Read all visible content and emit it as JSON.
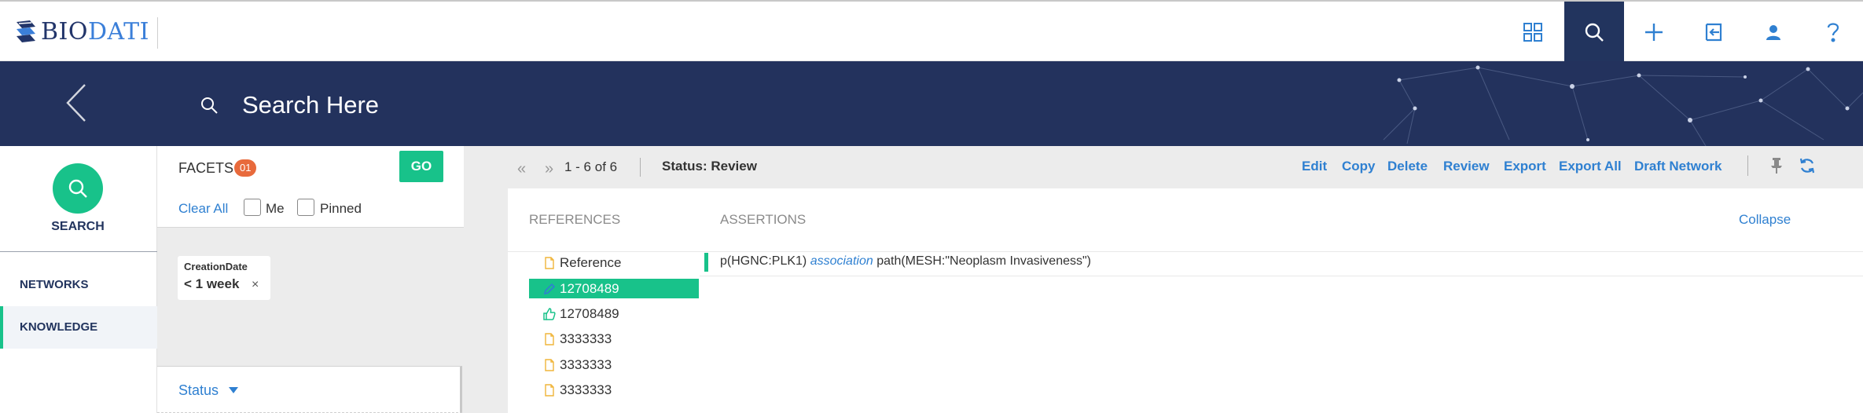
{
  "header": {
    "logo_bio": "BIO",
    "logo_dati": "DATI",
    "icons": [
      "grid-icon",
      "search-icon",
      "plus-icon",
      "import-icon",
      "user-icon",
      "help-icon"
    ]
  },
  "banner": {
    "search_placeholder": "Search Here"
  },
  "leftnav": {
    "search_label": "SEARCH",
    "items": [
      {
        "label": "NETWORKS",
        "active": false
      },
      {
        "label": "KNOWLEDGE",
        "active": true
      }
    ]
  },
  "facets": {
    "title": "FACETS",
    "count": "01",
    "go_label": "GO",
    "clear_all": "Clear All",
    "me_label": "Me",
    "pinned_label": "Pinned",
    "chip": {
      "label": "CreationDate",
      "value": "< 1 week",
      "remove": "×"
    },
    "status_label": "Status"
  },
  "toolbar": {
    "prev": "«",
    "next": "»",
    "range": "1 - 6 of 6",
    "status_prefix": "Status:",
    "status_value": "Review",
    "actions": [
      "Edit",
      "Copy",
      "Delete",
      "Review",
      "Export",
      "Export All",
      "Draft Network"
    ]
  },
  "results": {
    "references_header": "REFERENCES",
    "assertions_header": "ASSERTIONS",
    "collapse": "Collapse",
    "references": [
      {
        "label": "Reference",
        "icon": "file-icon",
        "selected": false
      },
      {
        "label": "12708489",
        "icon": "edit-icon",
        "selected": true
      },
      {
        "label": "12708489",
        "icon": "thumbs-up-icon",
        "selected": false
      },
      {
        "label": "3333333",
        "icon": "file-icon",
        "selected": false
      },
      {
        "label": "3333333",
        "icon": "file-icon",
        "selected": false
      },
      {
        "label": "3333333",
        "icon": "file-icon",
        "selected": false
      }
    ],
    "assertion": {
      "subject": "p(HGNC:PLK1)",
      "relation": "association",
      "object": "path(MESH:\"Neoplasm Invasiveness\")"
    }
  },
  "colors": {
    "navy": "#23325d",
    "green": "#18c28a",
    "link_blue": "#2f80d1",
    "badge_orange": "#e86a3c"
  }
}
